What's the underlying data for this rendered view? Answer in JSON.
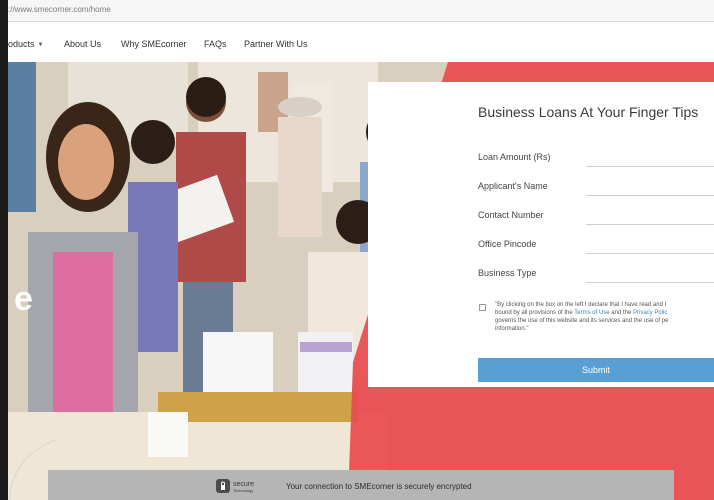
{
  "browser": {
    "url": "://www.smecorner.com/home"
  },
  "nav": {
    "items": [
      "oducts",
      "About Us",
      "Why SMEcorner",
      "FAQs",
      "Partner With Us"
    ]
  },
  "hero": {
    "partial_heading": "e"
  },
  "form": {
    "title": "Business Loans At Your Finger Tips",
    "fields": [
      "Loan Amount (Rs)",
      "Applicant's Name",
      "Contact Number",
      "Office Pincode",
      "Business Type"
    ],
    "consent_line1": "\"By clicking on the box on the left I declare that I have read and I",
    "consent_line2_pre": "bound by all provisions of the ",
    "consent_terms": "Terms of Use",
    "consent_line2_mid": " and the ",
    "consent_privacy": "Privacy Polic",
    "consent_line3": "governs the use of this website and its services and the use of pe",
    "consent_line4": "information.\"",
    "submit_label": "Submit"
  },
  "secure_banner": {
    "badge_main": "secure",
    "badge_sub": "Technology",
    "text": "Your connection to SMEcorner is securely encrypted"
  },
  "colors": {
    "accent_red": "#e94b4f",
    "submit_blue": "#5a9fd4"
  }
}
